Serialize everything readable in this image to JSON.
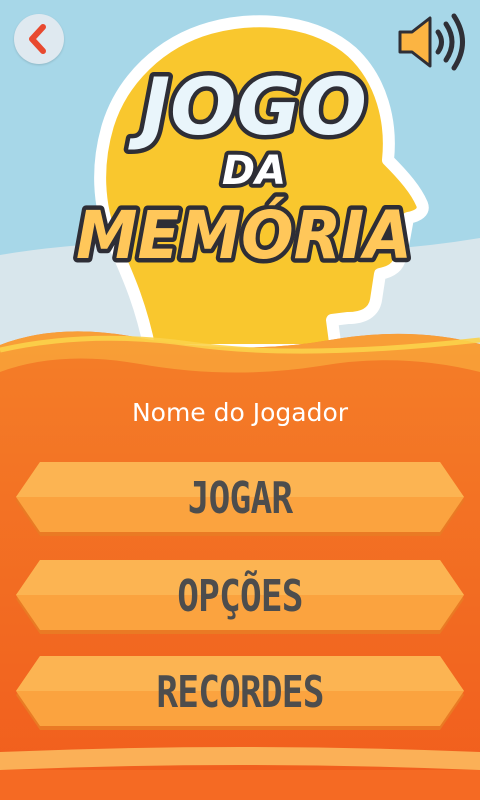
{
  "colors": {
    "sky": "#a6d8e8",
    "hills": "#d7e6ec",
    "head": "#f9c72e",
    "orange_dark": "#f36a22",
    "orange_light": "#f8a53a",
    "button": "#fba33f",
    "button_text": "#4d4d4d"
  },
  "icons": {
    "back": "chevron-left-icon",
    "sound": "speaker-volume-icon",
    "head": "head-silhouette-icon"
  },
  "title": {
    "line1": "JOGO",
    "line2": "DA",
    "line3": "MEMÓRIA"
  },
  "player": {
    "name": "Nome do Jogador"
  },
  "menu": {
    "play": "JOGAR",
    "options": "OPÇÕES",
    "records": "RECORDES"
  }
}
